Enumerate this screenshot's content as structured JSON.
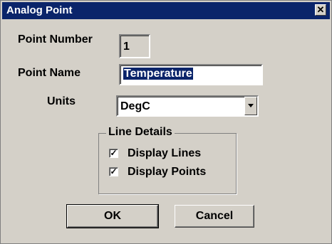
{
  "window": {
    "title": "Analog Point",
    "close_glyph": "✕"
  },
  "form": {
    "point_number_label": "Point Number",
    "point_number_value": "1",
    "point_name_label": "Point Name",
    "point_name_value": "Temperature",
    "units_label": "Units",
    "units_selected": "DegC"
  },
  "line_details": {
    "title": "Line Details",
    "display_lines_label": "Display Lines",
    "display_lines_checked": true,
    "display_points_label": "Display Points",
    "display_points_checked": true,
    "check_glyph": "✓"
  },
  "buttons": {
    "ok_label": "OK",
    "cancel_label": "Cancel"
  }
}
